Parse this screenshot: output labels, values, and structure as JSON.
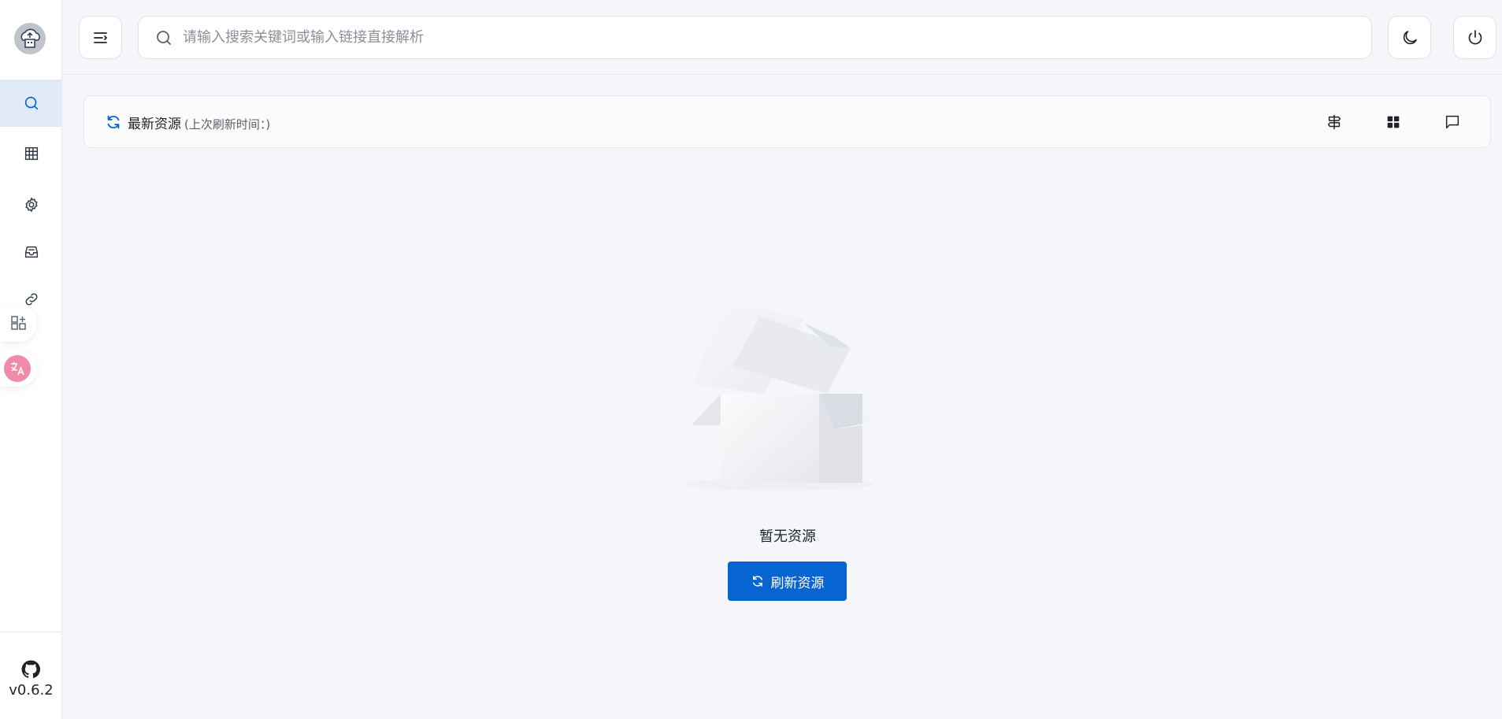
{
  "sidebar": {
    "logo_icon": "cloud-robot-logo",
    "nav": [
      {
        "name": "search",
        "icon": "search-icon",
        "active": true
      },
      {
        "name": "table",
        "icon": "table-icon",
        "active": false
      },
      {
        "name": "settings",
        "icon": "gear-icon",
        "active": false
      },
      {
        "name": "inbox",
        "icon": "inbox-icon",
        "active": false
      },
      {
        "name": "link",
        "icon": "link-icon",
        "active": false
      }
    ],
    "floating": [
      {
        "name": "apps",
        "icon": "apps-add-icon"
      },
      {
        "name": "translate",
        "icon": "translate-icon"
      }
    ],
    "github_icon": "github-icon",
    "version": "v0.6.2"
  },
  "topbar": {
    "menu_icon": "menu-toggle-icon",
    "search_placeholder": "请输入搜索关键词或输入链接直接解析",
    "theme_icon": "moon-icon",
    "power_icon": "power-icon"
  },
  "panel": {
    "title": "最新资源",
    "subtitle": "(上次刷新时间：)",
    "icons": [
      "filter-sign-icon",
      "grid-icon",
      "message-icon"
    ]
  },
  "empty": {
    "text": "暂无资源",
    "button_label": "刷新资源"
  },
  "colors": {
    "accent": "#0765d1",
    "active_nav_bg": "#e1ebf7",
    "background": "#f4f6fa"
  }
}
